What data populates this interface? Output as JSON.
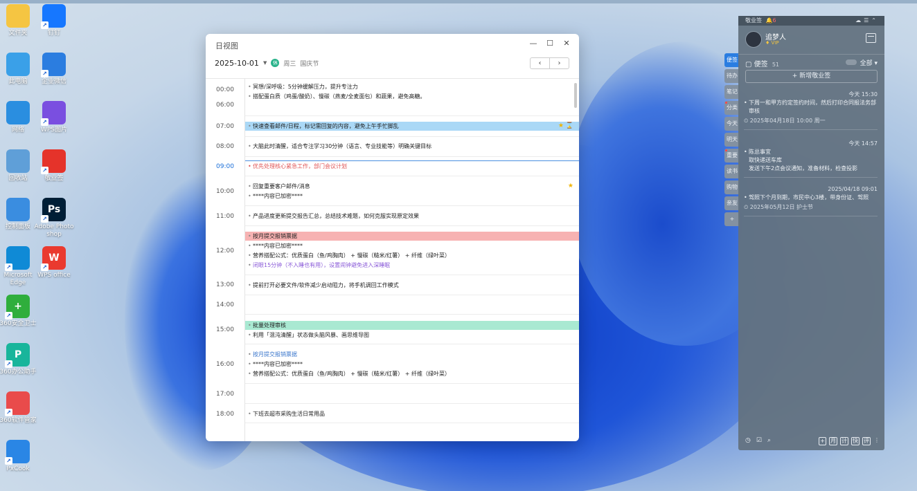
{
  "desktop": {
    "icons": [
      {
        "label": "文件夹",
        "icon": "folder-icon",
        "color": "#f5c542"
      },
      {
        "label": "钉钉",
        "icon": "dingtalk-icon",
        "color": "#1677ff"
      },
      {
        "label": "此电脑",
        "icon": "computer-icon",
        "color": "#3aa0e8"
      },
      {
        "label": "企业微信",
        "icon": "wecom-icon",
        "color": "#2b7de0"
      },
      {
        "label": "网络",
        "icon": "network-icon",
        "color": "#2a8ee0"
      },
      {
        "label": "WPS图片",
        "icon": "wps-picture-icon",
        "color": "#7a4fe0"
      },
      {
        "label": "回收站",
        "icon": "recycle-bin-icon",
        "color": "#5f9fd8"
      },
      {
        "label": "敬业签",
        "icon": "jingyeqian-icon",
        "color": "#e5332a"
      },
      {
        "label": "控制面板",
        "icon": "control-panel-icon",
        "color": "#3a8de0"
      },
      {
        "label": "Adobe Photo shop",
        "icon": "photoshop-icon",
        "color": "#001e36",
        "glyph": "Ps"
      },
      {
        "label": "Microsoft Edge",
        "icon": "edge-icon",
        "color": "#0f8ad6"
      },
      {
        "label": "WPS office",
        "icon": "wps-office-icon",
        "color": "#ea3a2f",
        "glyph": "W"
      },
      {
        "label": "360安全卫士",
        "icon": "360-security-icon",
        "color": "#2fae3c",
        "glyph": "+"
      },
      {
        "label": "360办公助手",
        "icon": "360-office-assistant-icon",
        "color": "#18b59b",
        "glyph": "P"
      },
      {
        "label": "360软件管家",
        "icon": "360-software-manager-icon",
        "color": "#e94b4b"
      },
      {
        "label": "PxCook",
        "icon": "pxcook-icon",
        "color": "#2a86e5"
      }
    ]
  },
  "dayview": {
    "title": "日视图",
    "date": "2025-10-01",
    "holiday_badge": "休",
    "weekday": "周三",
    "holiday_name": "国庆节",
    "prev": "‹",
    "next": "›",
    "times": [
      "00:00",
      "06:00",
      "07:00",
      "08:00",
      "09:00",
      "10:00",
      "11:00",
      "12:00",
      "13:00",
      "14:00",
      "15:00",
      "16:00",
      "17:00",
      "18:00"
    ],
    "events": {
      "e1": "冥想/深呼吸：5分钟缓解压力，提升专注力",
      "e2": "搭配蛋白质（鸡蛋/酸奶）、慢碳（燕麦/全麦面包）和蔬果，避免高糖。",
      "e3": "快速查看邮件/日程，标记需回复的内容，避免上午手忙脚乱",
      "e4": "大脑此时清醒，适合专注学习30分钟（语言、专业技能等）明确关键目标",
      "e5": "优先处理核心紧急工作，部门会议计划",
      "e6": "回复重要客户邮件/消息",
      "e7": "****内容已加密****",
      "e8": "产品进度更新提交报告汇总，总结技术难题，如何克服实现原定效果",
      "e9": "按月提交报销票据",
      "e10": "****内容已加密****",
      "e11": "营养搭配公式：优质蛋白（鱼/鸡胸肉） + 慢碳（糙米/红薯） + 纤维（绿叶菜）",
      "e12": "闭眼15分钟（不入睡也有用），设置闹钟避免进入深睡眠",
      "e13": "提前打开必要文件/软件减少启动阻力，将手机调回工作模式",
      "e14": "批量处理审核",
      "e15": "利用「混沌清醒」状态做头脑风暴、画思维导图",
      "e16": "按月提交报销票据",
      "e17": "****内容已加密****",
      "e18": "营养搭配公式：优质蛋白（鱼/鸡胸肉） + 慢碳（糙米/红薯） + 纤维（绿叶菜）",
      "e19": "下班去超市采购生活日常用品"
    }
  },
  "sidebar": {
    "app_name": "敬业签",
    "notif_count": "6",
    "username": "追梦人",
    "vip": "VIP",
    "section_label": "便签",
    "section_count": "51",
    "filter_label": "全部",
    "add_label": "+ 新增敬业签",
    "notes": [
      {
        "time": "今天 15:30",
        "body": "下周一和甲方约定签约时间，然后打印合同报法务部审核",
        "reminder": "2025年04月18日 10:00 周一"
      },
      {
        "time": "今天 14:57",
        "body": "陈总事宜\n取快递送车库\n发送下午2点会议通知，准备材料，检查投影"
      },
      {
        "time": "2025/04/18 09:01",
        "body": "驾照下个月到期，市民中心3楼，带身份证、驾照",
        "reminder": "2025年05月12日 护士节"
      }
    ],
    "tabs": [
      "便签",
      "待办",
      "笔记",
      "分类",
      "今天",
      "明天",
      "重要",
      "读书",
      "购物",
      "亲友",
      "+"
    ],
    "footer_buttons": [
      "+",
      "月",
      "计",
      "快",
      "评"
    ]
  },
  "colors": {
    "accent": "#2a7de1",
    "highlight_blue": "#aad8f6",
    "highlight_red": "#f7b2b2",
    "highlight_green": "#a9e9d2",
    "urgent_text": "#e05454"
  }
}
